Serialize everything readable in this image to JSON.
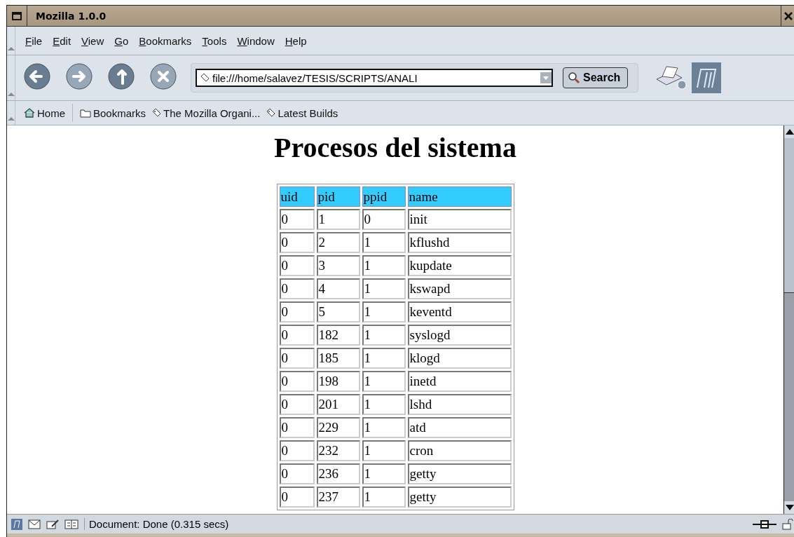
{
  "window": {
    "title": "Mozilla 1.0.0"
  },
  "menu": [
    "File",
    "Edit",
    "View",
    "Go",
    "Bookmarks",
    "Tools",
    "Window",
    "Help"
  ],
  "toolbar": {
    "url": "file:///home/salavez/TESIS/SCRIPTS/ANALI",
    "search_button": "Search"
  },
  "personal_bar": [
    {
      "kind": "home",
      "label": "Home"
    },
    {
      "kind": "folder",
      "label": "Bookmarks"
    },
    {
      "kind": "link",
      "label": "The Mozilla Organi..."
    },
    {
      "kind": "link",
      "label": "Latest Builds"
    }
  ],
  "page": {
    "heading": "Procesos del sistema",
    "table": {
      "columns": [
        "uid",
        "pid",
        "ppid",
        "name"
      ],
      "rows": [
        [
          "0",
          "1",
          "0",
          "init"
        ],
        [
          "0",
          "2",
          "1",
          "kflushd"
        ],
        [
          "0",
          "3",
          "1",
          "kupdate"
        ],
        [
          "0",
          "4",
          "1",
          "kswapd"
        ],
        [
          "0",
          "5",
          "1",
          "keventd"
        ],
        [
          "0",
          "182",
          "1",
          "syslogd"
        ],
        [
          "0",
          "185",
          "1",
          "klogd"
        ],
        [
          "0",
          "198",
          "1",
          "inetd"
        ],
        [
          "0",
          "201",
          "1",
          "lshd"
        ],
        [
          "0",
          "229",
          "1",
          "atd"
        ],
        [
          "0",
          "232",
          "1",
          "cron"
        ],
        [
          "0",
          "236",
          "1",
          "getty"
        ],
        [
          "0",
          "237",
          "1",
          "getty"
        ]
      ]
    }
  },
  "status_bar": {
    "text": "Document: Done (0.315 secs)"
  }
}
